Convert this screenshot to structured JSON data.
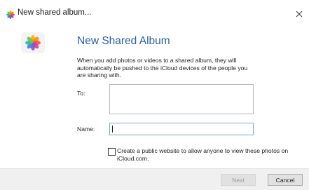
{
  "window": {
    "title": "New shared album...",
    "icon": "photos-icon",
    "close_icon": "close-icon"
  },
  "main": {
    "app_icon": "photos-icon",
    "heading": "New Shared Album",
    "description": "When you add photos or videos to a shared album, they will automatically be pushed to the iCloud devices of the people you are sharing with.",
    "to_label": "To:",
    "to_value": "",
    "name_label": "Name:",
    "name_value": "",
    "public_website_label": "Create a public website to allow anyone to view these photos on iCloud.com.",
    "public_website_checked": false
  },
  "footer": {
    "next_label": "Next",
    "cancel_label": "Cancel"
  },
  "colors": {
    "heading": "#2b5fa8",
    "focus_border": "#7aa6d6",
    "footer_bg": "#f0f0f0"
  }
}
